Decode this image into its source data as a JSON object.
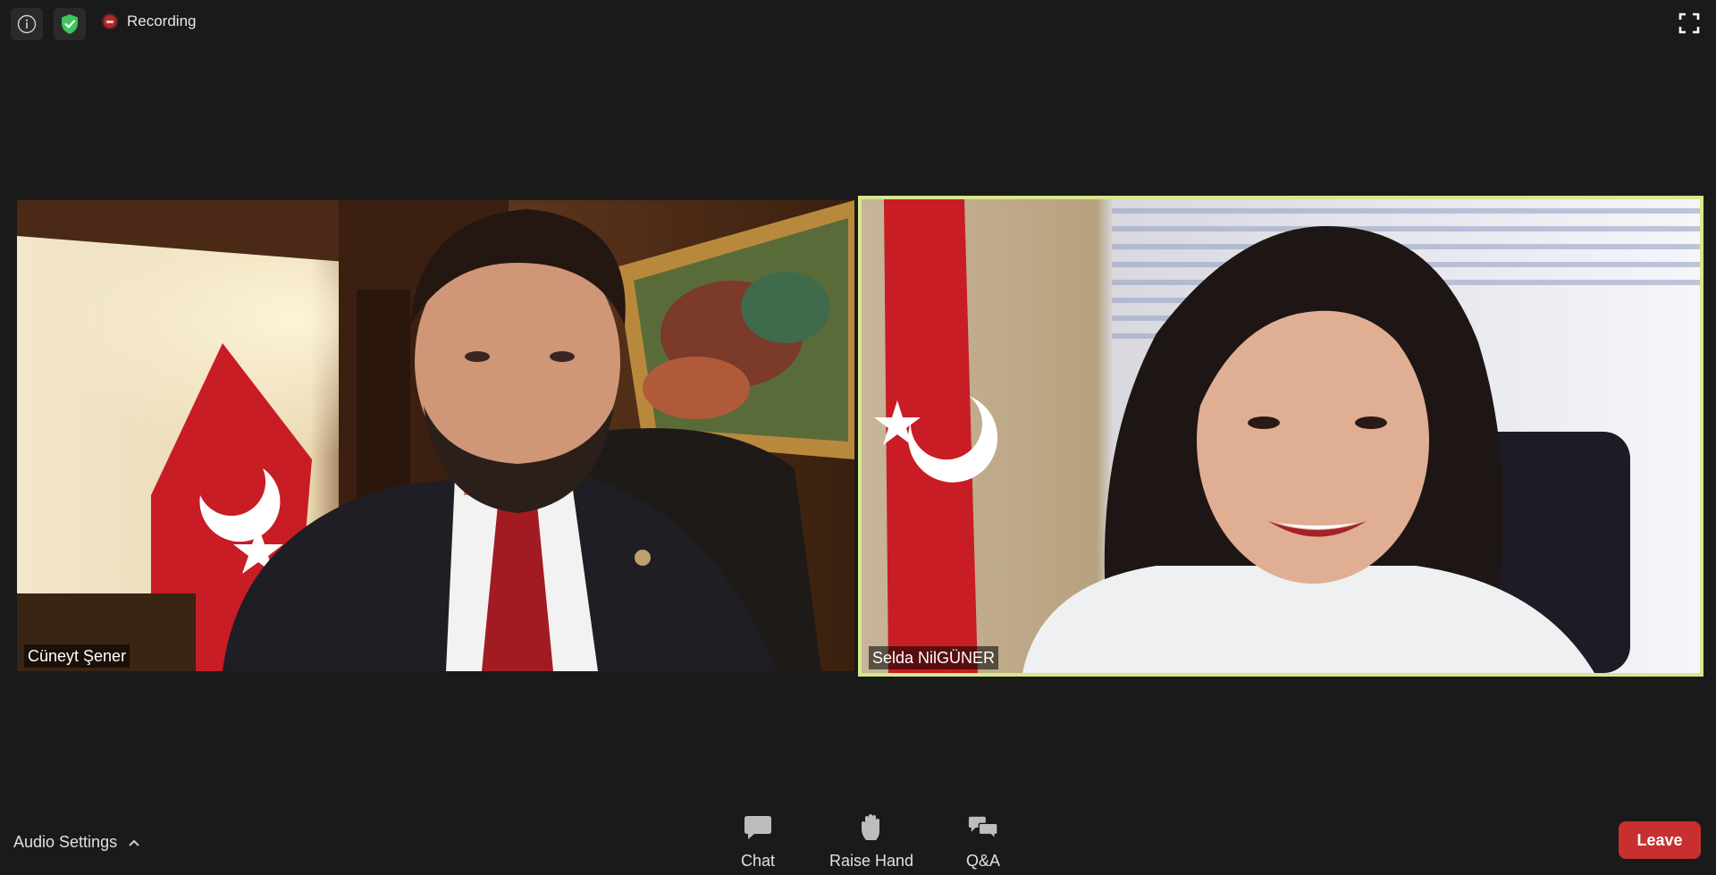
{
  "topbar": {
    "info_icon": "info-icon",
    "shield_icon": "shield-check-icon",
    "recording_label": "Recording",
    "fullscreen_icon": "fullscreen-icon"
  },
  "participants": [
    {
      "name": "Cüneyt Şener",
      "active_speaker": false
    },
    {
      "name": "Selda NilGÜNER",
      "active_speaker": true
    }
  ],
  "bottombar": {
    "audio_settings_label": "Audio Settings",
    "controls": [
      {
        "label": "Chat",
        "icon": "chat-bubble-icon"
      },
      {
        "label": "Raise Hand",
        "icon": "hand-icon"
      },
      {
        "label": "Q&A",
        "icon": "qa-bubbles-icon"
      }
    ],
    "leave_label": "Leave"
  },
  "colors": {
    "background": "#1a1a1a",
    "active_speaker_border": "#d7e88c",
    "leave_button": "#c8302f",
    "shield_green": "#3ec55b",
    "recording_red": "#b02a2a"
  }
}
